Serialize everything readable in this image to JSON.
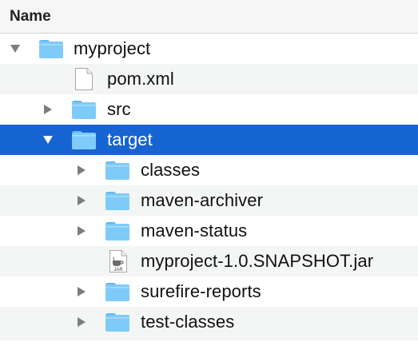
{
  "header": {
    "name_label": "Name"
  },
  "colors": {
    "selection": "#1664d1",
    "folder_body": "#7ecbf9",
    "folder_tab": "#5fb8f1",
    "disclosure": "#7d7d7d"
  },
  "rows": [
    {
      "label": "myproject",
      "type": "folder",
      "depth": 0,
      "expanded": true,
      "disclosure": "down"
    },
    {
      "label": "pom.xml",
      "type": "file",
      "depth": 1,
      "disclosure": "none"
    },
    {
      "label": "src",
      "type": "folder",
      "depth": 1,
      "disclosure": "right"
    },
    {
      "label": "target",
      "type": "folder",
      "depth": 1,
      "expanded": true,
      "disclosure": "down",
      "selected": true
    },
    {
      "label": "classes",
      "type": "folder",
      "depth": 2,
      "disclosure": "right"
    },
    {
      "label": "maven-archiver",
      "type": "folder",
      "depth": 2,
      "disclosure": "right"
    },
    {
      "label": "maven-status",
      "type": "folder",
      "depth": 2,
      "disclosure": "right"
    },
    {
      "label": "myproject-1.0.SNAPSHOT.jar",
      "type": "jar",
      "depth": 2,
      "disclosure": "none",
      "icon_text": "JAR"
    },
    {
      "label": "surefire-reports",
      "type": "folder",
      "depth": 2,
      "disclosure": "right"
    },
    {
      "label": "test-classes",
      "type": "folder",
      "depth": 2,
      "disclosure": "right"
    }
  ]
}
